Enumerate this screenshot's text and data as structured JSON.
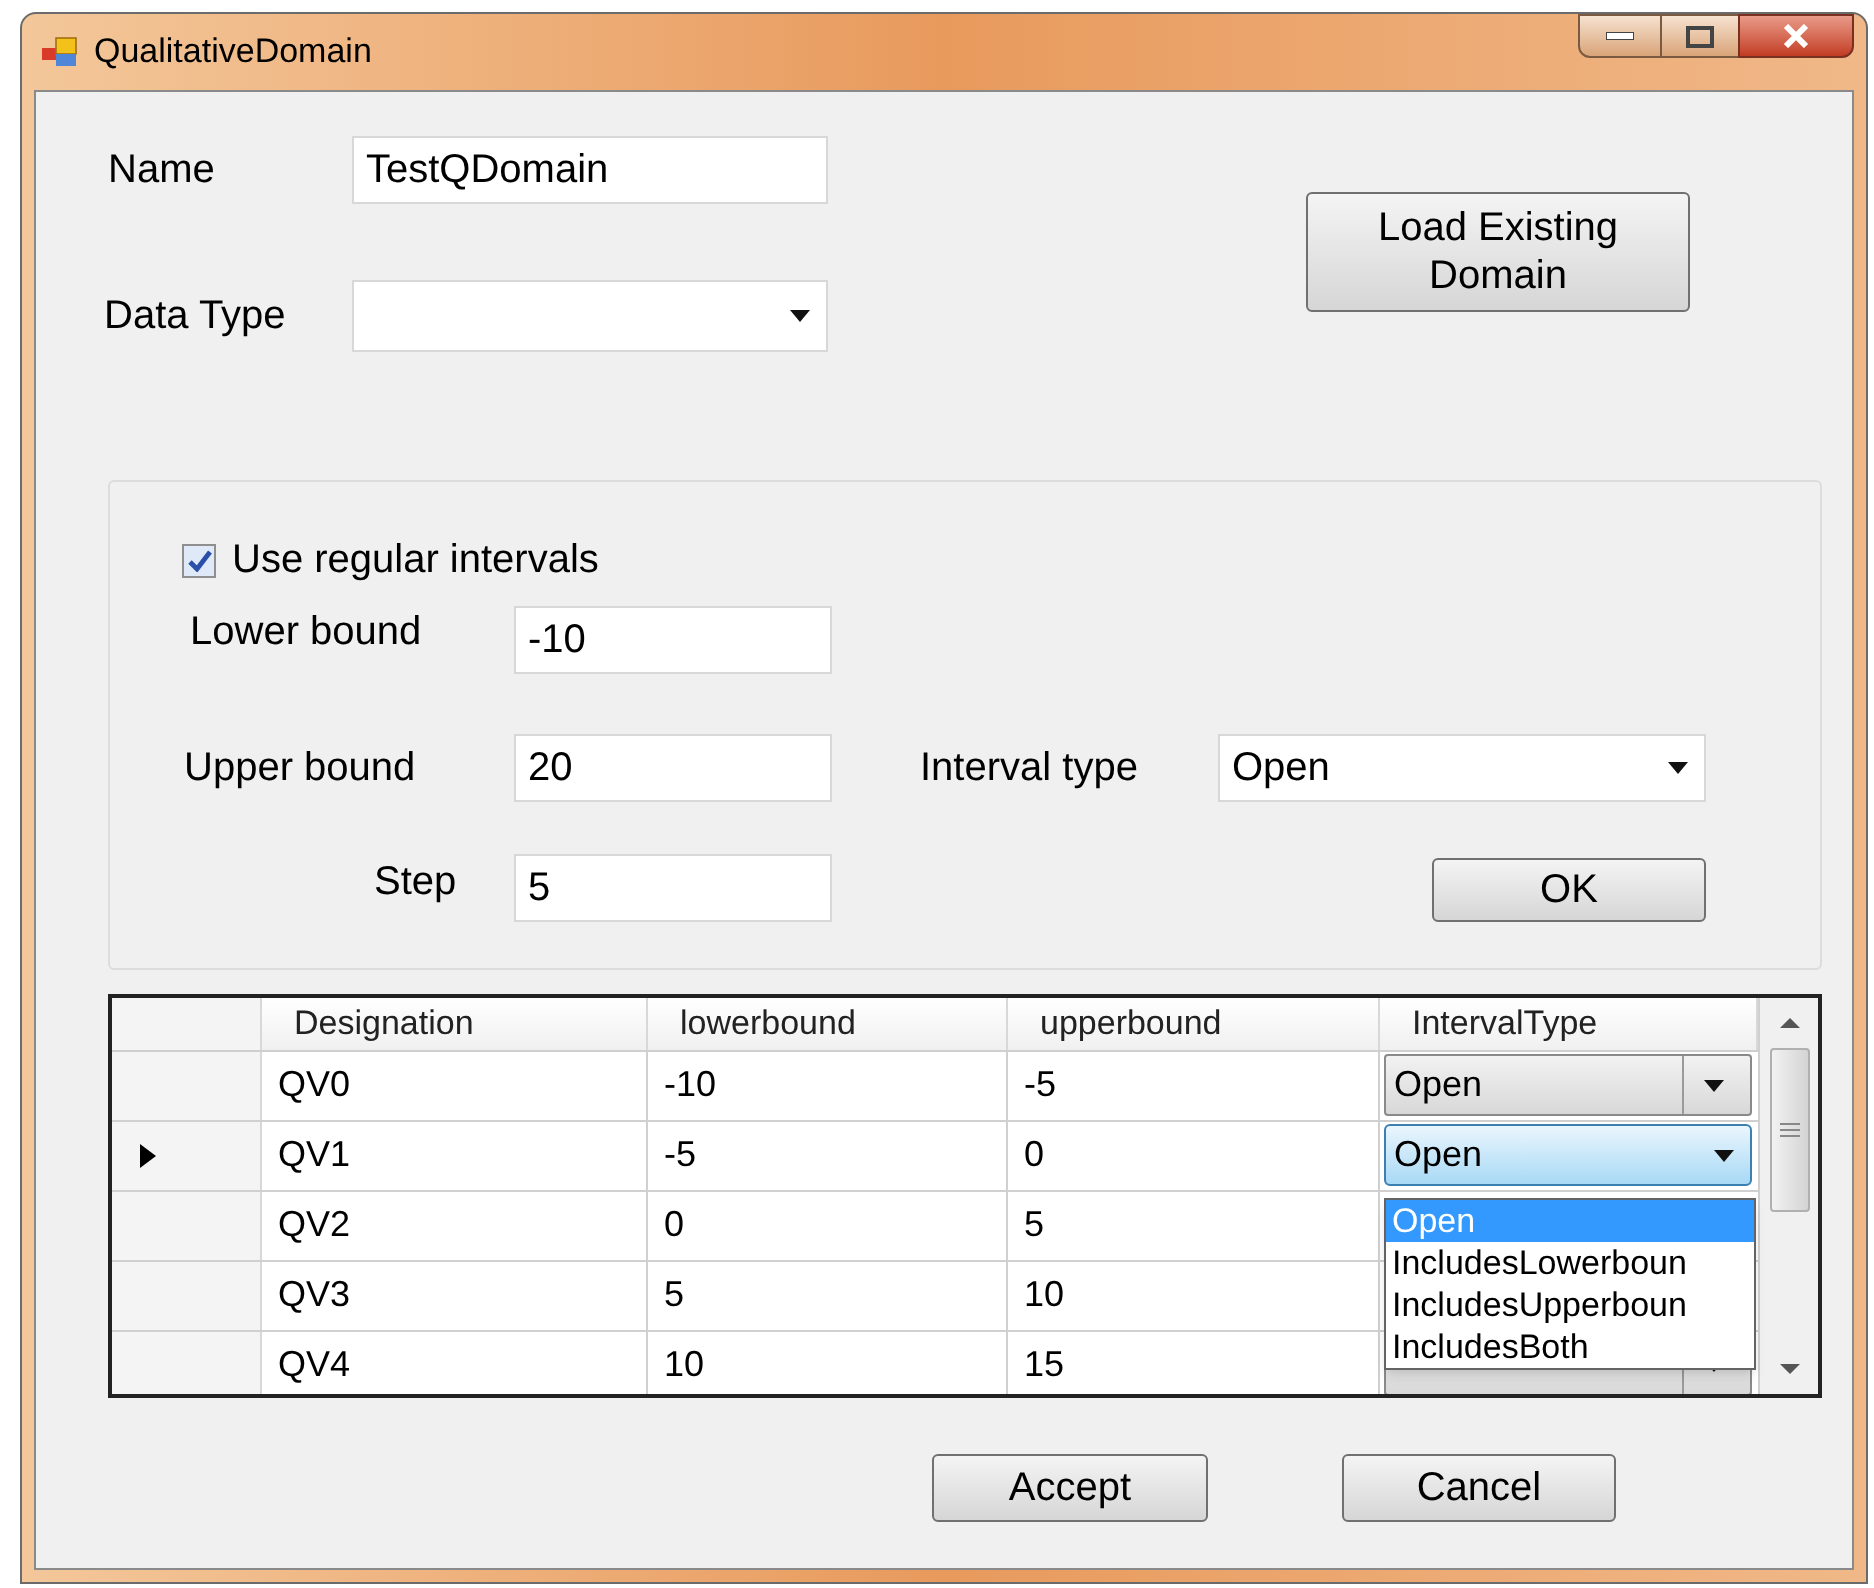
{
  "window": {
    "title": "QualitativeDomain"
  },
  "name_field": {
    "label": "Name",
    "value": "TestQDomain"
  },
  "data_type": {
    "label": "Data Type"
  },
  "load_button": "Load Existing Domain",
  "regular_intervals": {
    "label": "Use regular intervals",
    "checked": true
  },
  "lower_bound": {
    "label": "Lower bound",
    "value": "-10"
  },
  "upper_bound": {
    "label": "Upper bound",
    "value": "20"
  },
  "interval_type": {
    "label": "Interval type",
    "value": "Open"
  },
  "step": {
    "label": "Step",
    "value": "5"
  },
  "ok_button": "OK",
  "grid": {
    "columns": [
      "Designation",
      "lowerbound",
      "upperbound",
      "IntervalType"
    ],
    "rows": [
      {
        "current": false,
        "cells": [
          "QV0",
          "-10",
          "-5"
        ],
        "interval_dropdown": {
          "value": "Open",
          "focused": false
        }
      },
      {
        "current": true,
        "cells": [
          "QV1",
          "-5",
          "0"
        ],
        "interval_dropdown": {
          "value": "Open",
          "focused": true
        }
      },
      {
        "current": false,
        "cells": [
          "QV2",
          "0",
          "5"
        ]
      },
      {
        "current": false,
        "cells": [
          "QV3",
          "5",
          "10"
        ]
      },
      {
        "current": false,
        "cells": [
          "QV4",
          "10",
          "15"
        ],
        "interval_dropdown": {
          "focused": false
        }
      }
    ],
    "dropdown": [
      {
        "label": "Open",
        "selected": true
      },
      {
        "label": "IncludesLowerboun",
        "selected": false
      },
      {
        "label": "IncludesUpperboun",
        "selected": false
      },
      {
        "label": "IncludesBoth",
        "selected": false
      }
    ]
  },
  "buttons": [
    "Accept",
    "Cancel"
  ]
}
